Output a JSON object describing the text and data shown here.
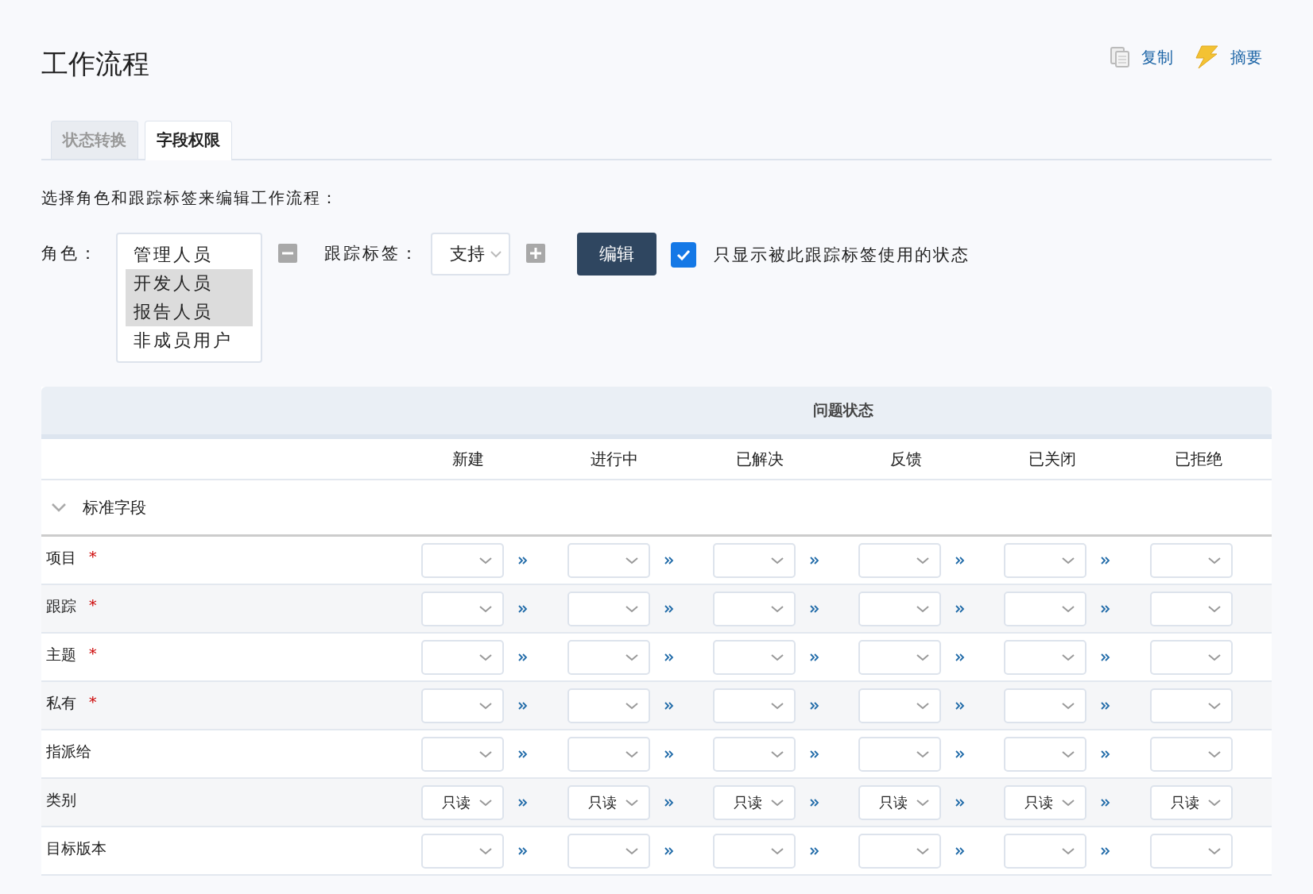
{
  "page": {
    "title": "工作流程",
    "actions": [
      {
        "kind": "copy",
        "label": "复制"
      },
      {
        "kind": "summary",
        "label": "摘要"
      }
    ]
  },
  "tabs": [
    {
      "label": "状态转换",
      "selected": false
    },
    {
      "label": "字段权限",
      "selected": true
    }
  ],
  "instruction": "选择角色和跟踪标签来编辑工作流程：",
  "filters": {
    "role_label": "角色：",
    "roles": [
      {
        "label": "管理人员",
        "selected": false
      },
      {
        "label": "开发人员",
        "selected": true
      },
      {
        "label": "报告人员",
        "selected": true
      },
      {
        "label": "非成员用户",
        "selected": false
      }
    ],
    "tracker_label": "跟踪标签：",
    "tracker_value": "支持",
    "edit_button": "编辑",
    "only_used": {
      "label": "只显示被此跟踪标签使用的状态",
      "checked": true
    }
  },
  "table": {
    "group_header": "问题状态",
    "statuses": [
      "新建",
      "进行中",
      "已解决",
      "反馈",
      "已关闭",
      "已拒绝"
    ],
    "section": {
      "label": "标准字段",
      "expanded": true
    },
    "rows": [
      {
        "label": "项目",
        "required_mark": "*"
      },
      {
        "label": "跟踪",
        "required_mark": "*"
      },
      {
        "label": "主题",
        "required_mark": "*"
      },
      {
        "label": "私有",
        "required_mark": "*"
      },
      {
        "label": "指派给"
      },
      {
        "label": "类别",
        "values": [
          "只读",
          "只读",
          "只读",
          "只读",
          "只读",
          "只读"
        ]
      },
      {
        "label": "目标版本"
      }
    ]
  }
}
